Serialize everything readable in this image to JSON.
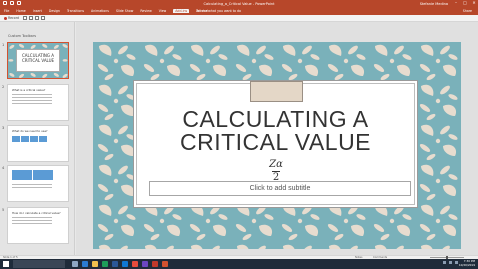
{
  "window": {
    "title": "Calculating_a_Critical Value - PowerPoint",
    "user": "Stefanie Medina",
    "controls": [
      "–",
      "□",
      "✕"
    ]
  },
  "ribbon": {
    "tabs": [
      "File",
      "Home",
      "Insert",
      "Design",
      "Transitions",
      "Animations",
      "Slide Show",
      "Review",
      "View",
      "Add-ins",
      "Acrobat"
    ],
    "active_tab": "Add-ins",
    "tell_me": "Tell me what you want to do",
    "share": "Share",
    "record_label": "Record"
  },
  "thumbnails": {
    "pane_title": "Custom Toolbars",
    "slides": [
      {
        "number": "1",
        "title": "CALCULATING A CRITICAL VALUE"
      },
      {
        "number": "2",
        "title": "What is a critical value?"
      },
      {
        "number": "3",
        "title": "What do we need to use?"
      },
      {
        "number": "4",
        "title": ""
      },
      {
        "number": "5",
        "title": "How do I calculate a critical value?"
      }
    ]
  },
  "slide": {
    "title": "CALCULATING  A CRITICAL VALUE",
    "formula_numerator": "Zα",
    "formula_denominator": "2",
    "subtitle_placeholder": "Click to add subtitle"
  },
  "status": {
    "slide_indicator": "Slide 1 of 5",
    "notes": "Notes",
    "comments": "Comments"
  },
  "taskbar": {
    "time": "7:30 PM",
    "date": "10/20/2019"
  },
  "colors": {
    "accent": "#b7472a",
    "slide_bg": "#7ab1ba",
    "pattern_light": "#e7dccf"
  }
}
